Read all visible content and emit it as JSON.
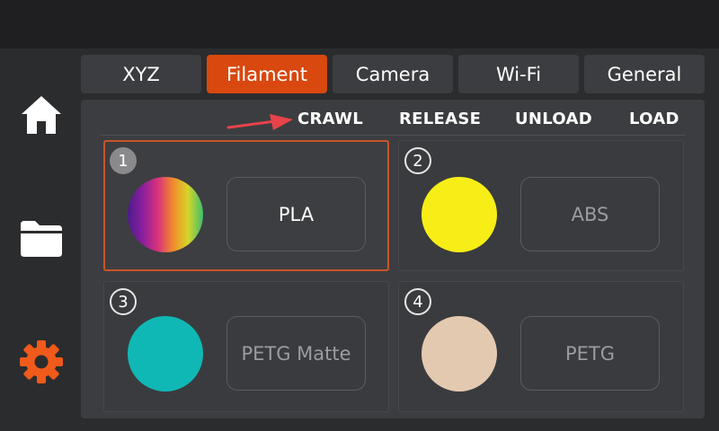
{
  "tabs": [
    {
      "label": "XYZ",
      "active": false
    },
    {
      "label": "Filament",
      "active": true
    },
    {
      "label": "Camera",
      "active": false
    },
    {
      "label": "Wi-Fi",
      "active": false
    },
    {
      "label": "General",
      "active": false
    }
  ],
  "sidebar": {
    "items": [
      {
        "icon": "home-icon",
        "color": "#ffffff"
      },
      {
        "icon": "folder-icon",
        "color": "#ffffff"
      },
      {
        "icon": "gear-icon",
        "color": "#f05a1a"
      }
    ]
  },
  "actions": {
    "crawl": "CRAWL",
    "release": "RELEASE",
    "unload": "UNLOAD",
    "load": "LOAD"
  },
  "slots": [
    {
      "number": "1",
      "material": "PLA",
      "color": "rainbow",
      "selected": true
    },
    {
      "number": "2",
      "material": "ABS",
      "color": "#f7ee17",
      "selected": false
    },
    {
      "number": "3",
      "material": "PETG Matte",
      "color": "#10b8b5",
      "selected": false
    },
    {
      "number": "4",
      "material": "PETG",
      "color": "#e4c9b1",
      "selected": false
    }
  ],
  "colors": {
    "accent": "#d8480f",
    "selected_border": "#c9552a",
    "arrow": "#e8434a"
  }
}
